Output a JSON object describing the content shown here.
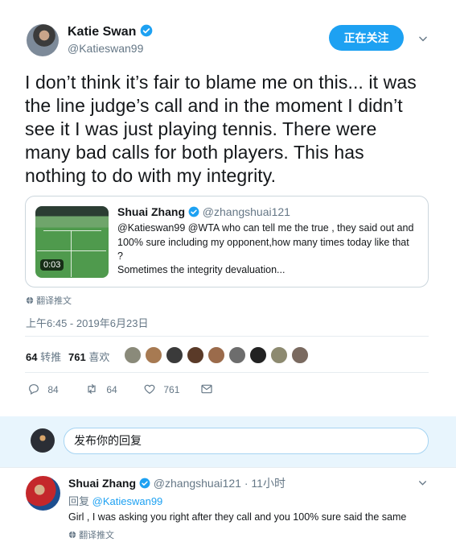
{
  "tweet": {
    "author_name": "Katie Swan",
    "author_handle": "@Katieswan99",
    "follow_label": "正在关注",
    "text": "I don’t think it’s fair to blame me on this... it was the line judge’s call and in the moment I didn’t see it I was just playing tennis. There were many bad calls for both players. This has nothing to do with my integrity.",
    "translate_label": "翻译推文",
    "timestamp": "上午6:45 - 2019年6月23日",
    "retweets_count": "64",
    "retweets_label": "转推",
    "likes_count": "761",
    "likes_label": "喜欢",
    "actions": {
      "reply_count": "84",
      "retweet_count": "64",
      "like_count": "761"
    }
  },
  "quote": {
    "author_name": "Shuai Zhang",
    "author_handle": "@zhangshuai121",
    "text": "@Katieswan99 @WTA who can tell me the true , they said out and 100% sure including my opponent,how many times today like that ?",
    "text2": "Sometimes the integrity devaluation...",
    "video_duration": "0:03"
  },
  "reply_box": {
    "placeholder": "发布你的回复"
  },
  "reply": {
    "author_name": "Shuai Zhang",
    "author_handle": "@zhangshuai121",
    "time": "· 11小时",
    "replying_prefix": "回复",
    "replying_to": "@Katieswan99",
    "text": "Girl , I was asking you right after they call and you 100% sure said the same",
    "translate_label": "翻译推文"
  },
  "colors": {
    "accent": "#1da1f2",
    "muted": "#657786",
    "text": "#14171a"
  },
  "icons": [
    "verified-badge-icon",
    "chevron-down-icon",
    "globe-icon",
    "reply-icon",
    "retweet-icon",
    "heart-icon",
    "envelope-icon"
  ]
}
